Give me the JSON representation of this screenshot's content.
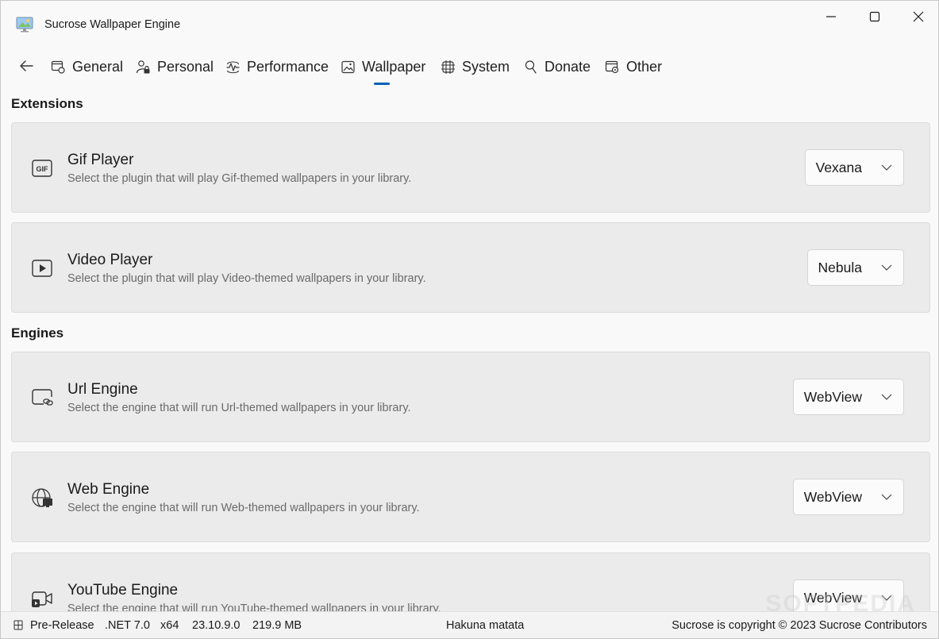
{
  "window": {
    "title": "Sucrose Wallpaper Engine"
  },
  "nav": {
    "items": [
      {
        "label": "General",
        "icon": "general-icon"
      },
      {
        "label": "Personal",
        "icon": "personal-icon"
      },
      {
        "label": "Performance",
        "icon": "performance-icon"
      },
      {
        "label": "Wallpaper",
        "icon": "wallpaper-icon",
        "selected": true
      },
      {
        "label": "System",
        "icon": "system-icon"
      },
      {
        "label": "Donate",
        "icon": "donate-icon"
      },
      {
        "label": "Other",
        "icon": "other-icon"
      }
    ]
  },
  "sections": {
    "extensions": {
      "title": "Extensions",
      "cards": [
        {
          "title": "Gif Player",
          "description": "Select the plugin that will play Gif-themed wallpapers in your library.",
          "value": "Vexana",
          "icon": "gif-icon"
        },
        {
          "title": "Video Player",
          "description": "Select the plugin that will play Video-themed wallpapers in your library.",
          "value": "Nebula",
          "icon": "video-play-icon"
        }
      ]
    },
    "engines": {
      "title": "Engines",
      "cards": [
        {
          "title": "Url Engine",
          "description": "Select the engine that will run Url-themed wallpapers in your library.",
          "value": "WebView",
          "icon": "url-icon"
        },
        {
          "title": "Web Engine",
          "description": "Select the engine that will run Web-themed wallpapers in your library.",
          "value": "WebView",
          "icon": "globe-icon"
        },
        {
          "title": "YouTube Engine",
          "description": "Select the engine that will run YouTube-themed wallpapers in your library.",
          "value": "WebView",
          "icon": "video-camera-icon"
        }
      ]
    }
  },
  "status": {
    "channel": "Pre-Release",
    "framework": ".NET 7.0",
    "arch": "x64",
    "version": "23.10.9.0",
    "memory": "219.9 MB",
    "message": "Hakuna matata",
    "copyright": "Sucrose is copyright © 2023 Sucrose Contributors"
  },
  "watermark": "SOFTPEDIA",
  "colors": {
    "accent": "#005fb8",
    "card": "#ebebeb",
    "background": "#f9f9f9"
  }
}
